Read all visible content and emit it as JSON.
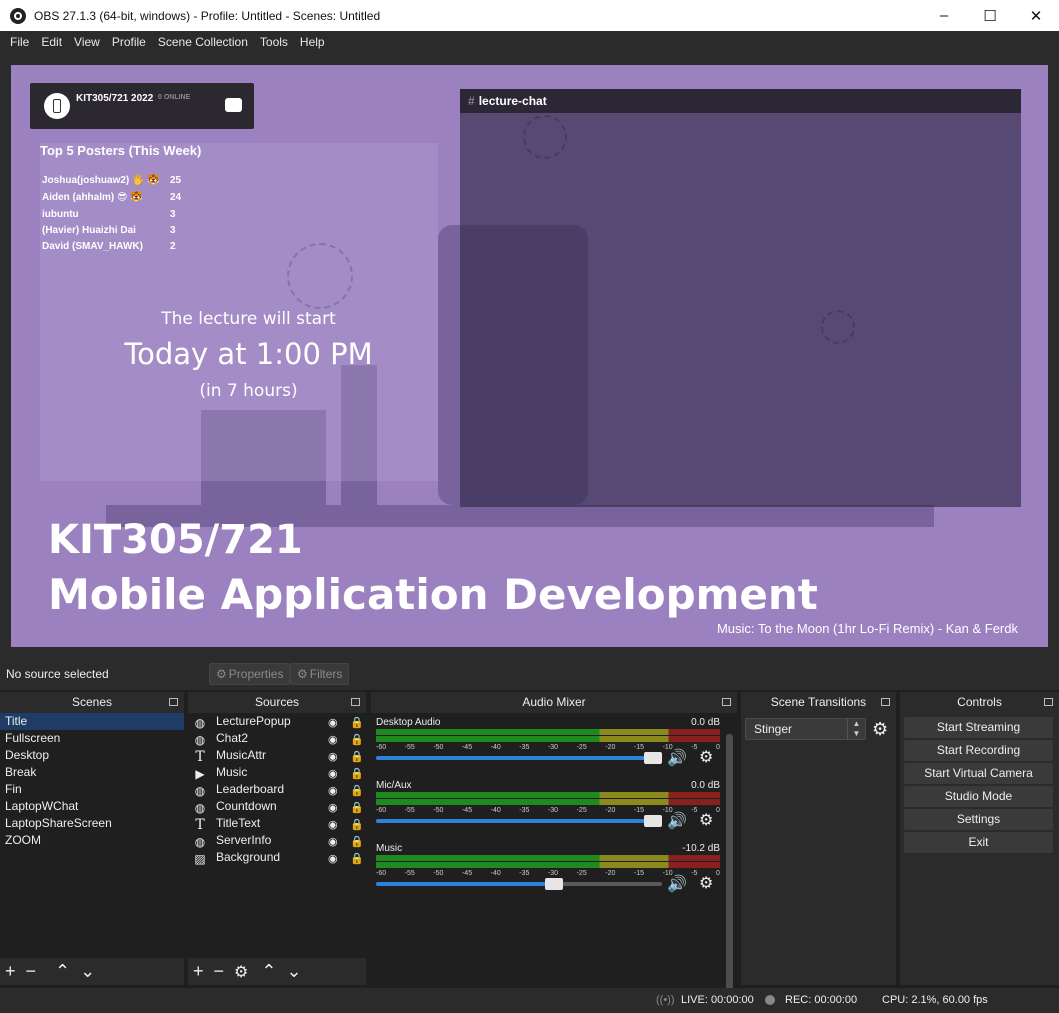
{
  "window": {
    "title": "OBS 27.1.3 (64-bit, windows) - Profile: Untitled - Scenes: Untitled",
    "minimize": "–",
    "maximize": "☐",
    "close": "✕"
  },
  "menu": [
    "File",
    "Edit",
    "View",
    "Profile",
    "Scene Collection",
    "Tools",
    "Help"
  ],
  "preview": {
    "discord": {
      "server": "KIT305/721 2022",
      "online": "0 ONLINE"
    },
    "leaderboard": {
      "title": "Top 5 Posters (This Week)",
      "rows": [
        {
          "name": "Joshua(joshuaw2) 🖐 🐯",
          "count": "25"
        },
        {
          "name": "Aiden (ahhalm) 😎 🐯",
          "count": "24"
        },
        {
          "name": "iubuntu",
          "count": "3"
        },
        {
          "name": "(Havier) Huaizhi Dai",
          "count": "3"
        },
        {
          "name": "David (SMAV_HAWK)",
          "count": "2"
        }
      ]
    },
    "countdown": {
      "line1": "The lecture will start",
      "line2": "Today at 1:00 PM",
      "line3": "(in 7 hours)"
    },
    "chat": {
      "hash": "#",
      "channel": "lecture-chat"
    },
    "title_line1": "KIT305/721",
    "title_line2": "Mobile Application Development",
    "music": "Music: To the Moon (1hr Lo-Fi Remix) - Kan & Ferdk",
    "background_color": "#9c81c1"
  },
  "toolbar": {
    "no_source": "No source selected",
    "properties": "Properties",
    "filters": "Filters"
  },
  "scenes": {
    "header": "Scenes",
    "items": [
      "Title",
      "Fullscreen",
      "Desktop",
      "Break",
      "Fin",
      "LaptopWChat",
      "LaptopShareScreen",
      "ZOOM"
    ],
    "selected": "Title"
  },
  "sources": {
    "header": "Sources",
    "items": [
      {
        "name": "LecturePopup",
        "icon": "globe-icon"
      },
      {
        "name": "Chat2",
        "icon": "globe-icon"
      },
      {
        "name": "MusicAttr",
        "icon": "text-icon"
      },
      {
        "name": "Music",
        "icon": "play-icon"
      },
      {
        "name": "Leaderboard",
        "icon": "globe-icon"
      },
      {
        "name": "Countdown",
        "icon": "globe-icon"
      },
      {
        "name": "TitleText",
        "icon": "text-icon"
      },
      {
        "name": "ServerInfo",
        "icon": "globe-icon"
      },
      {
        "name": "Background",
        "icon": "image-icon"
      }
    ]
  },
  "mixer": {
    "header": "Audio Mixer",
    "ticks": [
      "-60",
      "-55",
      "-50",
      "-45",
      "-40",
      "-35",
      "-30",
      "-25",
      "-20",
      "-15",
      "-10",
      "-5",
      "0"
    ],
    "channels": [
      {
        "name": "Desktop Audio",
        "db": "0.0 dB",
        "volume": 1.0
      },
      {
        "name": "Mic/Aux",
        "db": "0.0 dB",
        "volume": 1.0
      },
      {
        "name": "Music",
        "db": "-10.2 dB",
        "volume": 0.63
      }
    ]
  },
  "transitions": {
    "header": "Scene Transitions",
    "selected": "Stinger"
  },
  "controls": {
    "header": "Controls",
    "buttons": [
      "Start Streaming",
      "Start Recording",
      "Start Virtual Camera",
      "Studio Mode",
      "Settings",
      "Exit"
    ]
  },
  "status": {
    "live": "LIVE: 00:00:00",
    "rec": "REC: 00:00:00",
    "cpu": "CPU: 2.1%, 60.00 fps"
  },
  "colors": {
    "accent": "#2a82da",
    "selection": "#1e3c66",
    "panel": "#2b2b2b",
    "list": "#1f1f1f"
  }
}
